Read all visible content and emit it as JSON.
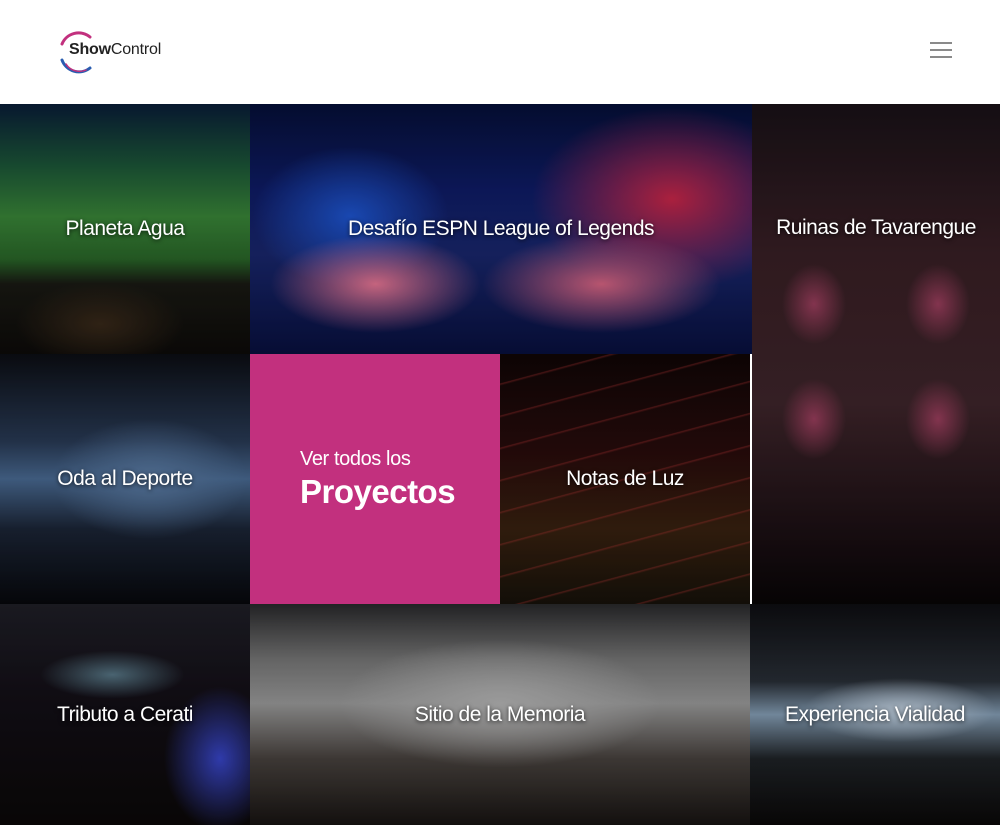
{
  "header": {
    "logo_bold": "Show",
    "logo_light": "Control",
    "colors": {
      "ring_magenta": "#c2307e",
      "ring_blue": "#2a5db0"
    }
  },
  "projects": [
    {
      "label": "Planeta Agua"
    },
    {
      "label": "Desafío ESPN League of Legends"
    },
    {
      "label": "Ruinas de Tavarengue"
    },
    {
      "label": "Oda al Deporte"
    },
    {
      "label": "Notas de Luz"
    },
    {
      "label": "Tributo a Cerati"
    },
    {
      "label": "Sitio de la Memoria"
    },
    {
      "label": "Experiencia Vialidad"
    }
  ],
  "cta": {
    "line1": "Ver todos los",
    "line2": "Proyectos",
    "color": "#c2307e"
  },
  "icons": {
    "menu": "hamburger-menu-icon"
  }
}
